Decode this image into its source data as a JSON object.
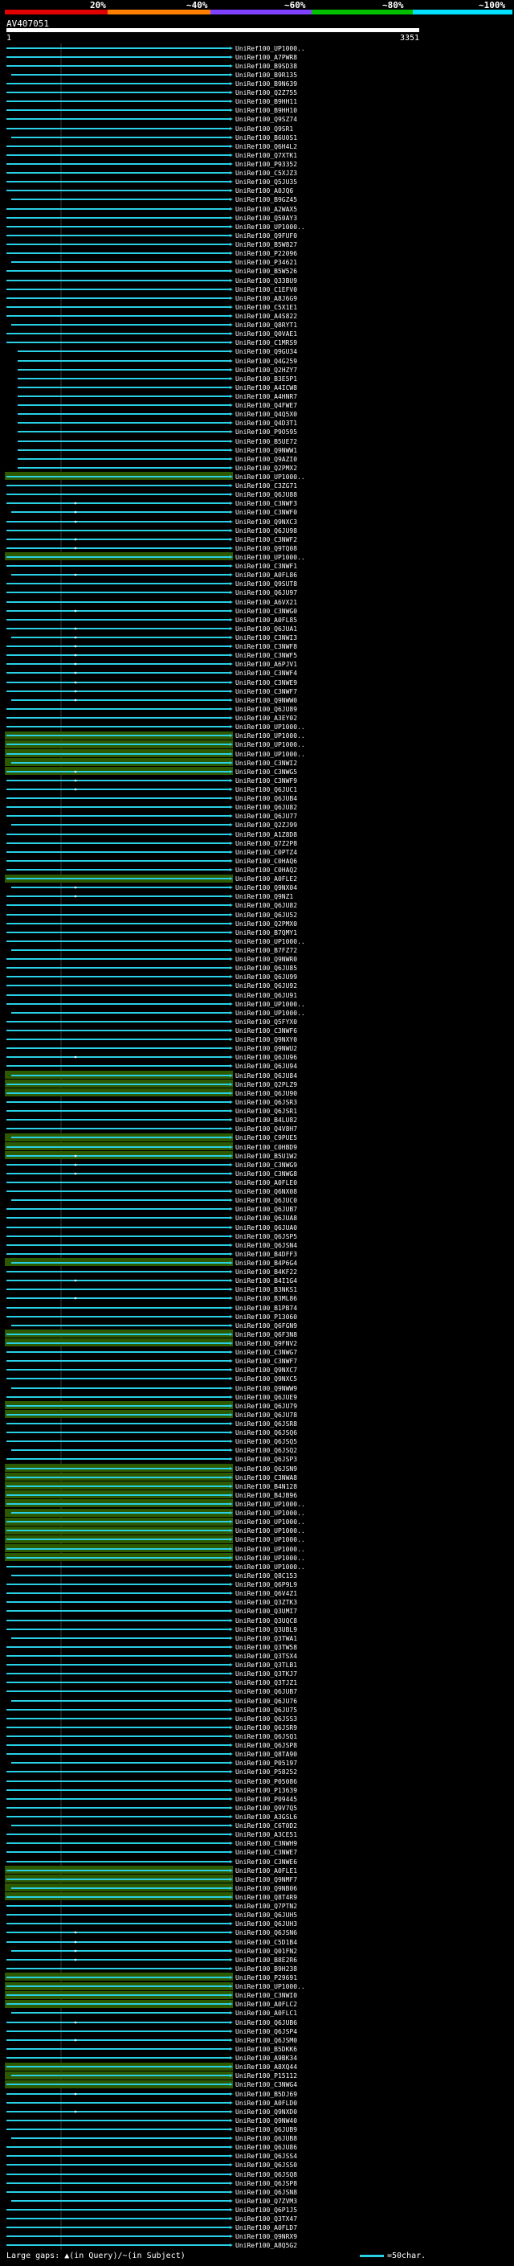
{
  "header": {
    "pct_labels": [
      "20%",
      "~40%",
      "~60%",
      "~80%",
      "~100%"
    ],
    "bar_colors": [
      "#e00000",
      "#ff7f00",
      "#8040ff",
      "#00c000",
      "#00e0ff"
    ]
  },
  "query": {
    "name": "AV407051",
    "start": "1",
    "end": "3351"
  },
  "colors": {
    "hit_line": "#2ad0e6",
    "highlight_bg": "#2d5a00",
    "gap_mark": "#ffffff"
  },
  "hits": [
    "UniRef100_UP1000..",
    "UniRef100_A7PWR8",
    "UniRef100_B9SD38",
    "UniRef100_B9R135",
    "UniRef100_B9N639",
    "UniRef100_Q2Z755",
    "UniRef100_B9HH11",
    "UniRef100_B9HH10",
    "UniRef100_Q9SZ74",
    "UniRef100_Q9SR1",
    "UniRef100_B6U0S1",
    "UniRef100_Q6H4L2",
    "UniRef100_Q7XTK1",
    "UniRef100_P93352",
    "UniRef100_C5XJZ3",
    "UniRef100_Q5JU35",
    "UniRef100_A0JQ6",
    "UniRef100_B9GZ45",
    "UniRef100_A2WAX5",
    "UniRef100_Q50AY3",
    "UniRef100_UP1000..",
    "UniRef100_Q9FUF0",
    "UniRef100_B5W827",
    "UniRef100_P22096",
    "UniRef100_P34621",
    "UniRef100_B5W526",
    "UniRef100_Q33BU9",
    "UniRef100_C1EFV0",
    "UniRef100_A8J6G9",
    "UniRef100_C5X1E1",
    "UniRef100_A4S822",
    "UniRef100_Q8RYT1",
    "UniRef100_Q0VAE1",
    "UniRef100_C1MRS9",
    "UniRef100_Q9GU34",
    "UniRef100_Q4G259",
    "UniRef100_Q2HZY7",
    "UniRef100_B3E5P1",
    "UniRef100_A4ICW8",
    "UniRef100_A4HNR7",
    "UniRef100_Q4FWE7",
    "UniRef100_Q4Q5X0",
    "UniRef100_Q4D3T1",
    "UniRef100_P9O595",
    "UniRef100_B5UE72",
    "UniRef100_Q9NWW1",
    "UniRef100_Q9AZI0",
    "UniRef100_Q2PMX2",
    "UniRef100_UP1000..",
    "UniRef100_C3ZG71",
    "UniRef100_Q6JU88",
    "UniRef100_C3NWF3",
    "UniRef100_C3NWF0",
    "UniRef100_Q9NXC3",
    "UniRef100_Q6JU98",
    "UniRef100_C3NWF2",
    "UniRef100_Q9TQ08",
    "UniRef100_UP1000..",
    "UniRef100_C3NWF1",
    "UniRef100_A0FL86",
    "UniRef100_Q9SUT8",
    "UniRef100_Q6JU97",
    "UniRef100_A6VX21",
    "UniRef100_C3NWG0",
    "UniRef100_A0FL85",
    "UniRef100_Q6JUA1",
    "UniRef100_C3NWI3",
    "UniRef100_C3NWF8",
    "UniRef100_C3NWF5",
    "UniRef100_A6PJV1",
    "UniRef100_C3NWF4",
    "UniRef100_C3NWE9",
    "UniRef100_C3NWF7",
    "UniRef100_Q9NWW0",
    "UniRef100_Q6JU89",
    "UniRef100_A3EY02",
    "UniRef100_UP1000..",
    "UniRef100_UP1000..",
    "UniRef100_UP1000..",
    "UniRef100_UP1000..",
    "UniRef100_C3NWI2",
    "UniRef100_C3NWG5",
    "UniRef100_C3NWF9",
    "UniRef100_Q6JUC1",
    "UniRef100_Q6JUB4",
    "UniRef100_Q6JU82",
    "UniRef100_Q6JU77",
    "UniRef100_Q2ZJ99",
    "UniRef100_A1Z8D8",
    "UniRef100_Q7Z2P8",
    "UniRef100_C0PTZ4",
    "UniRef100_C0HAQ6",
    "UniRef100_C0HAQ2",
    "UniRef100_A0FLE2",
    "UniRef100_Q9NX04",
    "UniRef100_Q9NZ1",
    "UniRef100_Q6JU82",
    "UniRef100_Q6JU52",
    "UniRef100_Q2PMX0",
    "UniRef100_B7QMY1",
    "UniRef100_UP1000..",
    "UniRef100_B7FZ72",
    "UniRef100_Q9NWR0",
    "UniRef100_Q6JU85",
    "UniRef100_Q6JU99",
    "UniRef100_Q6JU92",
    "UniRef100_Q6JU91",
    "UniRef100_UP1000..",
    "UniRef100_UP1000..",
    "UniRef100_Q5FYX0",
    "UniRef100_C3NWF6",
    "UniRef100_Q9NXY0",
    "UniRef100_Q9NWU2",
    "UniRef100_Q6JU96",
    "UniRef100_Q6JU94",
    "UniRef100_Q6JU84",
    "UniRef100_Q2PLZ9",
    "UniRef100_Q6JU90",
    "UniRef100_Q6JSR3",
    "UniRef100_Q6JSR1",
    "UniRef100_B4LU82",
    "UniRef100_Q4V8H7",
    "UniRef100_C9PUE5",
    "UniRef100_C0HBD9",
    "UniRef100_B5U1W2",
    "UniRef100_C3NWG9",
    "UniRef100_C3NWG8",
    "UniRef100_A0FLE0",
    "UniRef100_Q6NX08",
    "UniRef100_Q6JUC0",
    "UniRef100_Q6JUB7",
    "UniRef100_Q6JUA8",
    "UniRef100_Q6JUA0",
    "UniRef100_Q6JSP5",
    "UniRef100_Q6JSN4",
    "UniRef100_B4DFF3",
    "UniRef100_B4P6G4",
    "UniRef100_B4KF22",
    "UniRef100_B4I1G4",
    "UniRef100_B3NKS1",
    "UniRef100_B3ML86",
    "UniRef100_B1PB74",
    "UniRef100_P13060",
    "UniRef100_Q6FGN9",
    "UniRef100_Q6F3N8",
    "UniRef100_Q9FNV2",
    "UniRef100_C3NWG7",
    "UniRef100_C3NWF7",
    "UniRef100_Q9NXC7",
    "UniRef100_Q9NXC5",
    "UniRef100_Q9NWW9",
    "UniRef100_Q6JUE9",
    "UniRef100_Q6JU79",
    "UniRef100_Q6JU78",
    "UniRef100_Q6JSR8",
    "UniRef100_Q6JSQ6",
    "UniRef100_Q6JSQ5",
    "UniRef100_Q6JSQ2",
    "UniRef100_Q6JSP3",
    "UniRef100_Q6JSN9",
    "UniRef100_C3NWA8",
    "UniRef100_B4N128",
    "UniRef100_B4JB96",
    "UniRef100_UP1000..",
    "UniRef100_UP1000..",
    "UniRef100_UP1000..",
    "UniRef100_UP1000..",
    "UniRef100_UP1000..",
    "UniRef100_UP1000..",
    "UniRef100_UP1000..",
    "UniRef100_UP1000..",
    "UniRef100_Q8C153",
    "UniRef100_Q6P9L9",
    "UniRef100_Q6V4Z1",
    "UniRef100_Q3ZTK3",
    "UniRef100_Q3UMI7",
    "UniRef100_Q3UQC8",
    "UniRef100_Q3UBL9",
    "UniRef100_Q3TWA1",
    "UniRef100_Q3TW58",
    "UniRef100_Q3TSX4",
    "UniRef100_Q3TLB1",
    "UniRef100_Q3TKJ7",
    "UniRef100_Q3TJZ1",
    "UniRef100_Q6JUB7",
    "UniRef100_Q6JU76",
    "UniRef100_Q6JU75",
    "UniRef100_Q6JSS3",
    "UniRef100_Q6JSR9",
    "UniRef100_Q6JSQ1",
    "UniRef100_Q6JSP8",
    "UniRef100_Q8TA90",
    "UniRef100_P05197",
    "UniRef100_P58252",
    "UniRef100_P05086",
    "UniRef100_P13639",
    "UniRef100_P09445",
    "UniRef100_Q9V7Q5",
    "UniRef100_A3GSL6",
    "UniRef100_C6T0D2",
    "UniRef100_A3CE51",
    "UniRef100_C3NWH9",
    "UniRef100_C3NWE7",
    "UniRef100_C3NWE6",
    "UniRef100_A0FLE1",
    "UniRef100_Q9NMF7",
    "UniRef100_Q9NB06",
    "UniRef100_Q8T4R9",
    "UniRef100_Q7PTN2",
    "UniRef100_Q6JUH5",
    "UniRef100_Q6JUH3",
    "UniRef100_Q6JSN6",
    "UniRef100_C5D1B4",
    "UniRef100_Q01FN2",
    "UniRef100_B8E2R6",
    "UniRef100_B9H238",
    "UniRef100_P29691",
    "UniRef100_UP1000..",
    "UniRef100_C3NWI0",
    "UniRef100_A0FLC2",
    "UniRef100_A0FLC1",
    "UniRef100_Q6JUB6",
    "UniRef100_Q6JSP4",
    "UniRef100_Q6JSM0",
    "UniRef100_B5DKK6",
    "UniRef100_A9BK34",
    "UniRef100_A8XQ44",
    "UniRef100_P15112",
    "UniRef100_C3NWG4",
    "UniRef100_B5DJ69",
    "UniRef100_A0FLD0",
    "UniRef100_Q9NXD0",
    "UniRef100_Q9NW40",
    "UniRef100_Q6JUB9",
    "UniRef100_Q6JUB8",
    "UniRef100_Q6JU86",
    "UniRef100_Q6JSS4",
    "UniRef100_Q6JSS0",
    "UniRef100_Q6JSQ8",
    "UniRef100_Q6JSP8",
    "UniRef100_Q6JSN8",
    "UniRef100_Q7ZVM3",
    "UniRef100_Q6P1J5",
    "UniRef100_Q3TX47",
    "UniRef100_A0FLD7",
    "UniRef100_Q9NRX9",
    "UniRef100_A8Q5G2"
  ],
  "footer": {
    "gaps_label": "Large gaps: ▲(in Query)/~(in Subject)",
    "scale_label": "=50char."
  }
}
